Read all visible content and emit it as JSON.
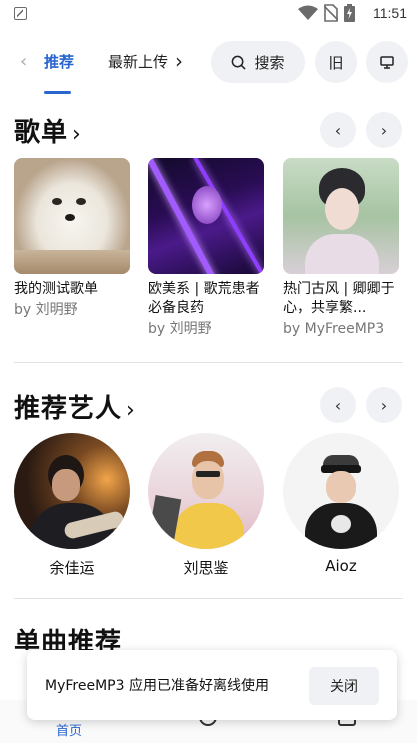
{
  "status_bar": {
    "time": "11:51",
    "icons": [
      "app-a-icon",
      "wifi-icon",
      "no-sim-icon",
      "battery-charging-icon"
    ]
  },
  "top_nav": {
    "tabs": [
      {
        "label": "推荐",
        "active": true
      },
      {
        "label": "最新上传",
        "active": false
      }
    ],
    "search_label": "搜索",
    "old_label": "旧",
    "monitor_icon": "monitor-icon"
  },
  "playlists": {
    "title": "歌单",
    "items": [
      {
        "title": "我的测试歌单",
        "by": "by 刘明野"
      },
      {
        "title": "欧美系 | 歌荒患者必备良药",
        "by": "by 刘明野"
      },
      {
        "title": "热门古风 | 卿卿于心，共享繁...",
        "by": "by MyFreeMP3"
      }
    ]
  },
  "artists": {
    "title": "推荐艺人",
    "items": [
      {
        "name": "余佳运"
      },
      {
        "name": "刘思鉴"
      },
      {
        "name": "Aioz"
      }
    ]
  },
  "singles": {
    "title": "单曲推荐"
  },
  "toast": {
    "message": "MyFreeMP3 应用已准备好离线使用",
    "close_label": "关闭"
  },
  "bottom_nav": {
    "home_label": "首页"
  },
  "colors": {
    "accent": "#2a66d0",
    "button_bg": "#eff1f4"
  }
}
